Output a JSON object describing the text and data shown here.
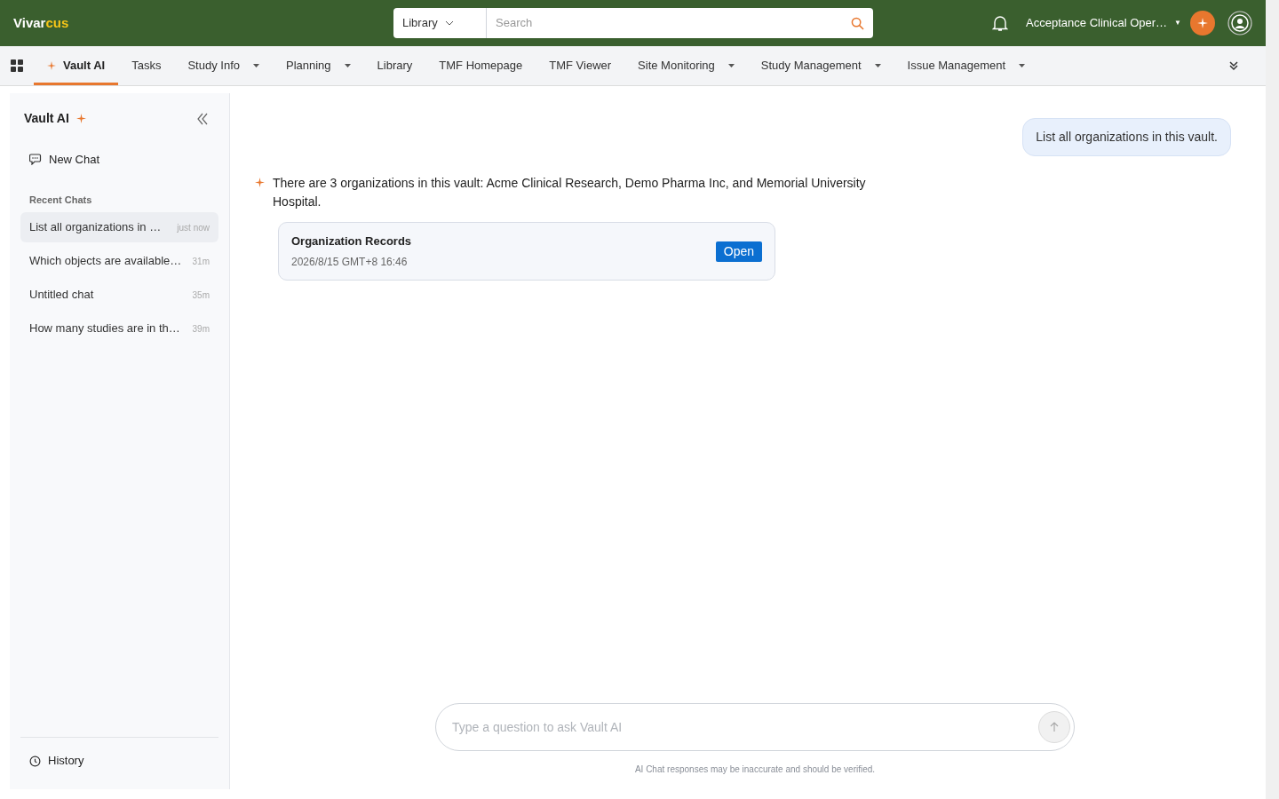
{
  "header": {
    "logo": {
      "main": "Vivar",
      "accent": "cus"
    },
    "scope": "Library",
    "search": {
      "placeholder": "Search"
    },
    "vault": "Acceptance Clinical Oper…",
    "vault_caret": "▼"
  },
  "tabs": [
    {
      "label": "Vault AI",
      "selected": true,
      "dropdown": false,
      "ai": true
    },
    {
      "label": "Tasks",
      "selected": false,
      "dropdown": false,
      "ai": false
    },
    {
      "label": "Study Info",
      "selected": false,
      "dropdown": true,
      "ai": false
    },
    {
      "label": "Planning",
      "selected": false,
      "dropdown": true,
      "ai": false
    },
    {
      "label": "Library",
      "selected": false,
      "dropdown": false,
      "ai": false
    },
    {
      "label": "TMF Homepage",
      "selected": false,
      "dropdown": false,
      "ai": false
    },
    {
      "label": "TMF Viewer",
      "selected": false,
      "dropdown": false,
      "ai": false
    },
    {
      "label": "Site Monitoring",
      "selected": false,
      "dropdown": true,
      "ai": false
    },
    {
      "label": "Study Management",
      "selected": false,
      "dropdown": true,
      "ai": false
    },
    {
      "label": "Issue Management",
      "selected": false,
      "dropdown": true,
      "ai": false
    }
  ],
  "sidebar": {
    "title": "Vault AI",
    "new_chat": "New Chat",
    "recent_label": "Recent Chats",
    "chats": [
      {
        "title": "List all organizations in …",
        "time": "just now",
        "selected": true
      },
      {
        "title": "Which objects are available…",
        "time": "31m",
        "selected": false
      },
      {
        "title": "Untitled chat",
        "time": "35m",
        "selected": false
      },
      {
        "title": "How many studies are in th…",
        "time": "39m",
        "selected": false
      }
    ],
    "history": "History"
  },
  "chat": {
    "messages": [
      {
        "kind": "user",
        "text": "List all organizations in this vault."
      },
      {
        "kind": "ai",
        "text": "There are 3 organizations in this vault: Acme Clinical Research, Demo Pharma Inc, and Memorial University Hospital.",
        "card": {
          "title": "Organization Records",
          "date": "2026/8/15 GMT+8 16:46",
          "button": "Open"
        }
      }
    ],
    "input": {
      "placeholder": "Type a question to ask Vault AI"
    },
    "disclaimer": "AI Chat responses may be inaccurate and should be verified."
  }
}
